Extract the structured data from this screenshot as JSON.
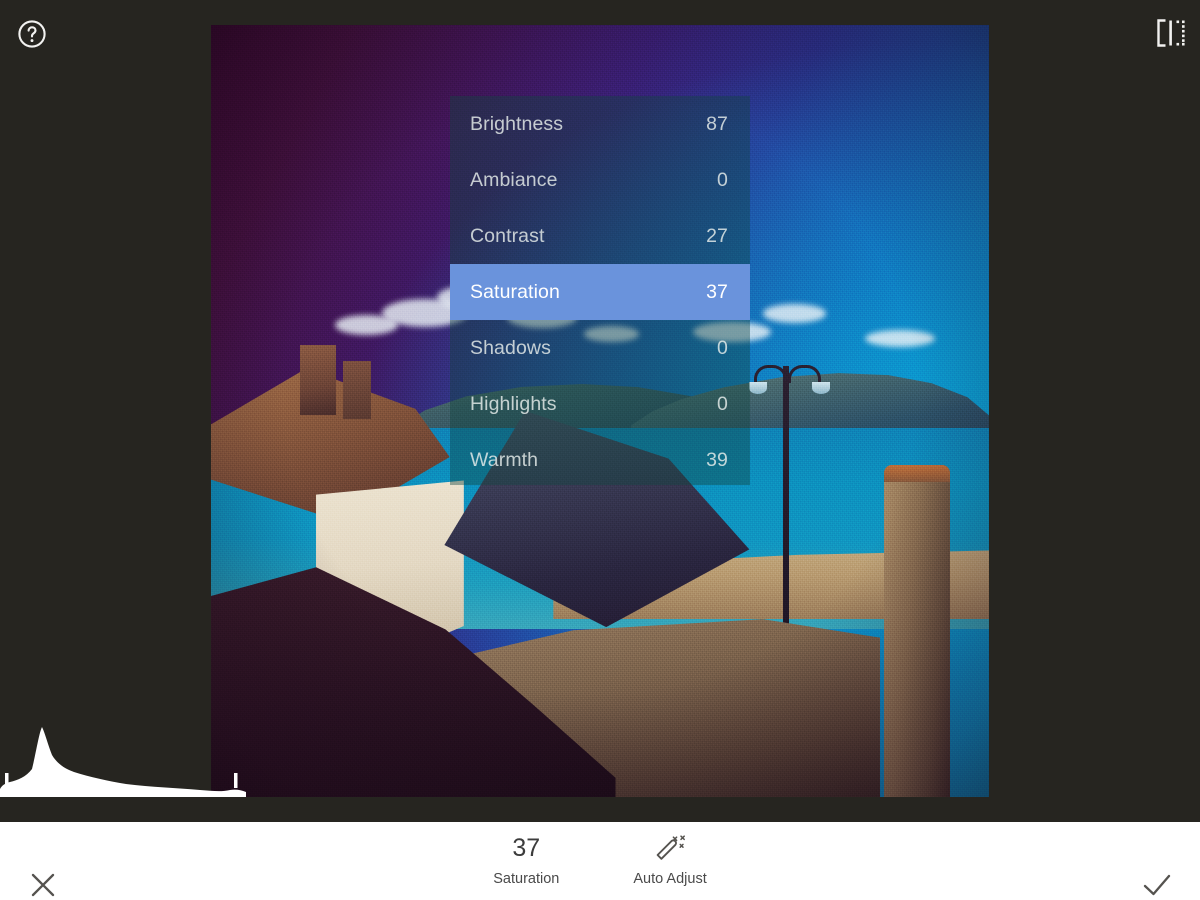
{
  "app": {
    "background_color": "#262520",
    "accent_color": "#6a93dc"
  },
  "topbar": {
    "help_icon": "help-circle-icon",
    "help_label": "Help",
    "compare_icon": "compare-before-after-icon",
    "compare_label": "Compare"
  },
  "photo": {
    "alt": "Coastal town photo with cottage roofs, sea, headland and beach, heavy film grain"
  },
  "adjust_panel": {
    "selected_index": 3,
    "rows": [
      {
        "label": "Brightness",
        "value": "87"
      },
      {
        "label": "Ambiance",
        "value": "0"
      },
      {
        "label": "Contrast",
        "value": "27"
      },
      {
        "label": "Saturation",
        "value": "37"
      },
      {
        "label": "Shadows",
        "value": "0"
      },
      {
        "label": "Highlights",
        "value": "0"
      },
      {
        "label": "Warmth",
        "value": "39"
      }
    ]
  },
  "histogram": {
    "label": "Tone histogram"
  },
  "bottombar": {
    "close_icon": "close-x-icon",
    "close_label": "Cancel",
    "done_icon": "checkmark-icon",
    "done_label": "Done",
    "current": {
      "value": "37",
      "label": "Saturation"
    },
    "auto_adjust": {
      "icon": "magic-wand-icon",
      "label": "Auto Adjust"
    }
  }
}
